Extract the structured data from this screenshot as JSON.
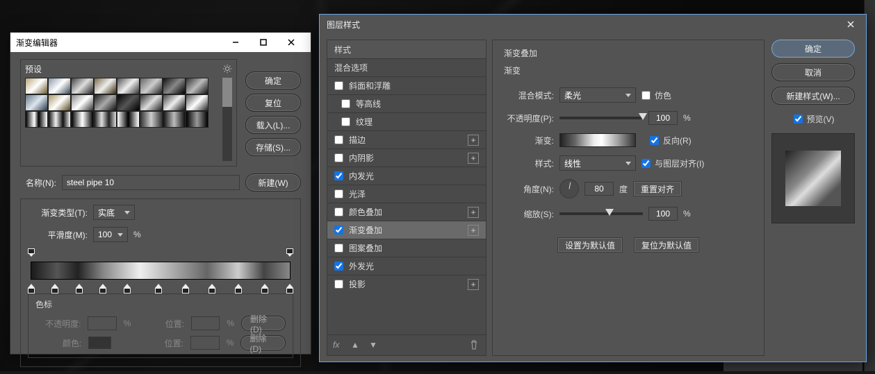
{
  "gradient_editor": {
    "title": "渐变编辑器",
    "presets_label": "预设",
    "buttons": {
      "ok": "确定",
      "reset": "复位",
      "load": "载入(L)...",
      "save": "存储(S)...",
      "new": "新建(W)"
    },
    "name_label": "名称(N):",
    "name_value": "steel pipe 10",
    "type_label": "渐变类型(T):",
    "type_value": "实底",
    "smooth_label": "平滑度(M):",
    "smooth_value": "100",
    "percent": "%",
    "colorstops": {
      "header": "色标",
      "opacity_label": "不透明度:",
      "position_label": "位置:",
      "color_label": "颜色:",
      "delete": "删除(D)"
    }
  },
  "layer_style": {
    "title": "图层样式",
    "left": {
      "styles": "样式",
      "blend_options": "混合选项",
      "bevel": "斜面和浮雕",
      "contour": "等高线",
      "texture": "纹理",
      "stroke": "描边",
      "inner_shadow": "内阴影",
      "inner_glow": "内发光",
      "satin": "光泽",
      "color_overlay": "颜色叠加",
      "gradient_overlay": "渐变叠加",
      "pattern_overlay": "图案叠加",
      "outer_glow": "外发光",
      "drop_shadow": "投影"
    },
    "mid": {
      "section": "渐变叠加",
      "sub": "渐变",
      "blend_mode_label": "混合模式:",
      "blend_mode_value": "柔光",
      "dither": "仿色",
      "opacity_label": "不透明度(P):",
      "opacity_value": "100",
      "percent": "%",
      "gradient_label": "渐变:",
      "reverse": "反向(R)",
      "style_label": "样式:",
      "style_value": "线性",
      "align": "与图层对齐(I)",
      "angle_label": "角度(N):",
      "angle_value": "80",
      "degree": "度",
      "reset_align": "重置对齐",
      "scale_label": "缩放(S):",
      "scale_value": "100",
      "set_default": "设置为默认值",
      "reset_default": "复位为默认值"
    },
    "right": {
      "ok": "确定",
      "cancel": "取消",
      "new_style": "新建样式(W)...",
      "preview": "预览(V)"
    }
  }
}
